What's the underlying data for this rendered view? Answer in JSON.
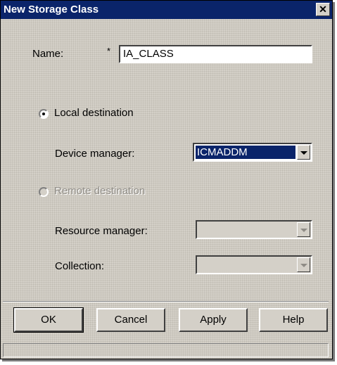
{
  "dialog": {
    "title": "New Storage Class",
    "close_glyph": "✕"
  },
  "name_field": {
    "label": "Name:",
    "required_mark": "*",
    "value": "IA_CLASS"
  },
  "local_destination": {
    "label": "Local destination",
    "selected": true,
    "device_manager_label": "Device manager:",
    "device_manager_value": "ICMADDM"
  },
  "remote_destination": {
    "label": "Remote destination",
    "selected": false,
    "enabled": false,
    "resource_manager_label": "Resource manager:",
    "resource_manager_value": "",
    "collection_label": "Collection:",
    "collection_value": ""
  },
  "buttons": {
    "ok": "OK",
    "cancel": "Cancel",
    "apply": "Apply",
    "help": "Help"
  },
  "colors": {
    "titlebar": "#0a246a",
    "face": "#d4d0c8",
    "selection": "#0a246a"
  }
}
